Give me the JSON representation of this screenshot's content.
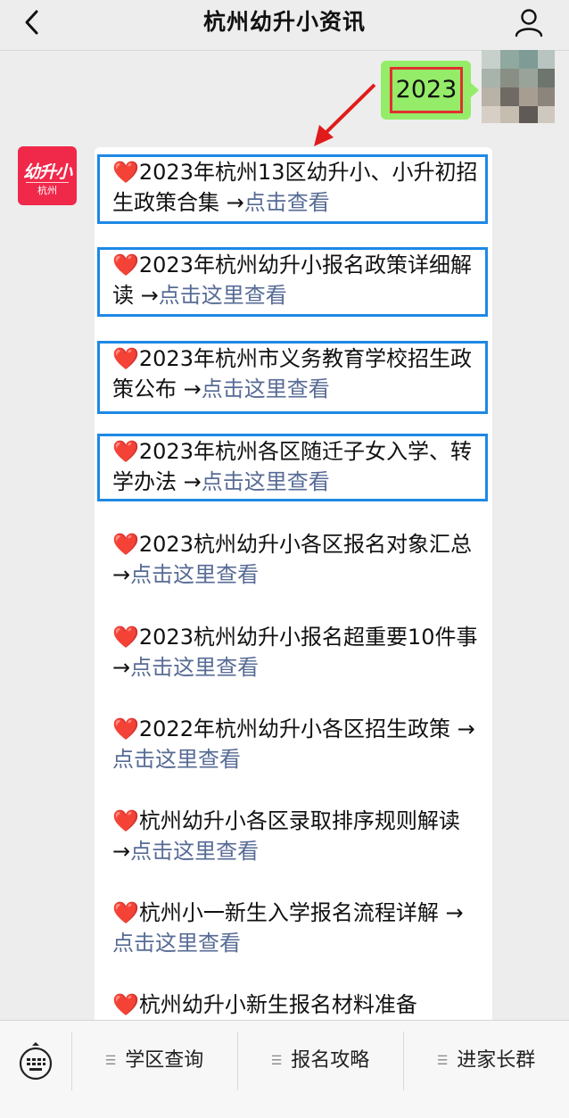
{
  "header": {
    "title": "杭州幼升小资讯",
    "back_icon": "chevron-left-icon",
    "profile_icon": "user-icon"
  },
  "outgoing_message": {
    "text": "2023"
  },
  "logo": {
    "main": "幼升小",
    "sub": "杭州"
  },
  "colors": {
    "out_bubble": "#95ec69",
    "link": "#576b95",
    "highlight_box": "#1e88e5",
    "highlight_text_box": "#e03030",
    "logo_bg": "#f0284a"
  },
  "items": [
    {
      "heart": "❤️",
      "text": "2023年杭州13区幼升小、小升初招生政策合集",
      "arrow": "→",
      "link": "点击查看"
    },
    {
      "heart": "❤️",
      "text": "2023年杭州幼升小报名政策详细解读",
      "arrow": "→",
      "link": "点击这里查看"
    },
    {
      "heart": "❤️",
      "text": "2023年杭州市义务教育学校招生政策公布",
      "arrow": "→",
      "link": "点击这里查看"
    },
    {
      "heart": "❤️",
      "text": "2023年杭州各区随迁子女入学、转学办法",
      "arrow": "→",
      "link": "点击这里查看"
    },
    {
      "heart": "❤️",
      "text": "2023杭州幼升小各区报名对象汇总",
      "arrow": "→",
      "link": "点击这里查看"
    },
    {
      "heart": "❤️",
      "text": "2023杭州幼升小报名超重要10件事",
      "arrow": "→",
      "link": "点击这里查看"
    },
    {
      "heart": "❤️",
      "text": "2022年杭州幼升小各区招生政策",
      "arrow": "→",
      "link": "点击这里查看"
    },
    {
      "heart": "❤️",
      "text": "杭州幼升小各区录取排序规则解读",
      "arrow": "→",
      "link": "点击这里查看"
    },
    {
      "heart": "❤️",
      "text": "杭州小一新生入学报名流程详解",
      "arrow": "→",
      "link": "点击这里查看"
    },
    {
      "heart": "❤️",
      "text": "杭州幼升小新生报名材料准备",
      "arrow": "",
      "link": ""
    }
  ],
  "bottom_bar": {
    "keyboard_icon": "keyboard-icon",
    "menu": [
      {
        "label": "学区查询"
      },
      {
        "label": "报名攻略"
      },
      {
        "label": "进家长群"
      }
    ]
  }
}
